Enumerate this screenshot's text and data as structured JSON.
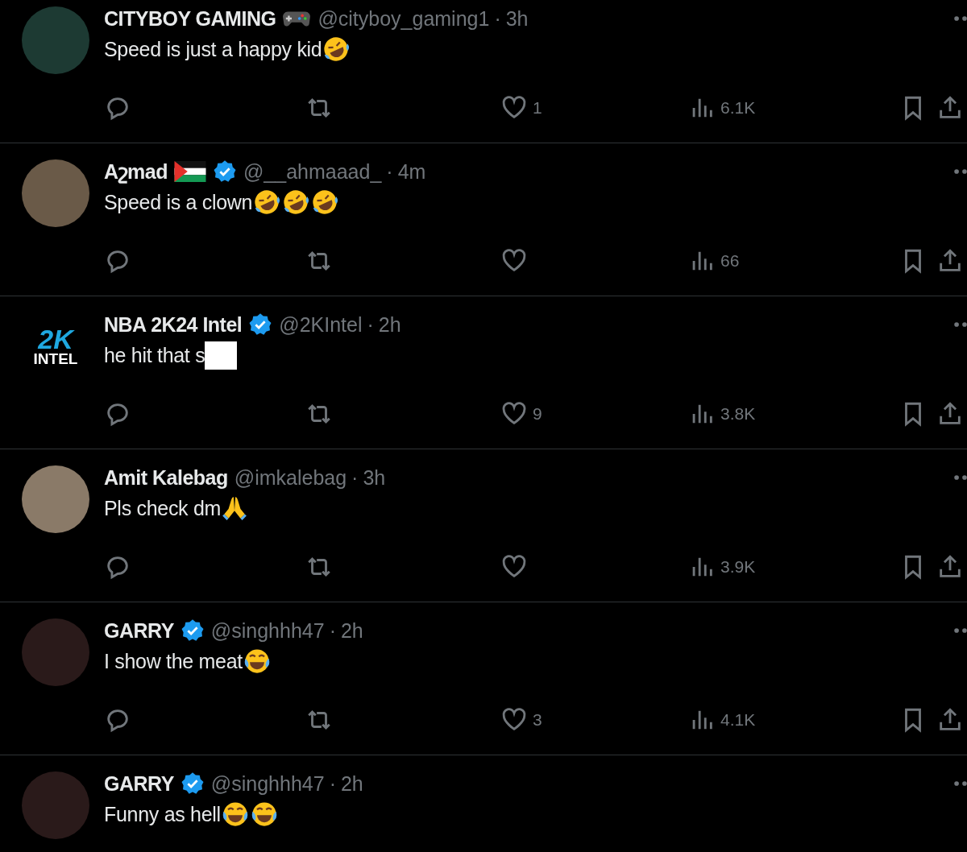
{
  "tweets": [
    {
      "avatar": {
        "kind": "photo"
      },
      "name": "CITYBOY GAMING",
      "name_badges": [
        {
          "kind": "gamepad"
        }
      ],
      "handle": "@cityboy_gaming1",
      "separator": "·",
      "time": "3h",
      "text": "Speed is just a happy kid",
      "emoji": [
        {
          "kind": "rofl"
        }
      ],
      "redacted": false,
      "actions": true,
      "likes": "1",
      "views": "6.1K"
    },
    {
      "avatar": {
        "kind": "photo"
      },
      "name": "Aշmad",
      "name_badges": [
        {
          "kind": "flag"
        },
        {
          "kind": "verified"
        }
      ],
      "handle": "@__ahmaaad_",
      "separator": "·",
      "time": "4m",
      "text": "Speed is a clown",
      "emoji": [
        {
          "kind": "rofl"
        },
        {
          "kind": "rofl"
        },
        {
          "kind": "rofl"
        }
      ],
      "redacted": false,
      "actions": true,
      "views": "66"
    },
    {
      "avatar": {
        "kind": "logo",
        "lines": [
          "2K",
          "INTEL"
        ]
      },
      "name": "NBA 2K24 Intel",
      "name_badges": [
        {
          "kind": "verified"
        }
      ],
      "handle": "@2KIntel",
      "separator": "·",
      "time": "2h",
      "text": "he hit that s",
      "redacted": true,
      "actions": true,
      "likes": "9",
      "views": "3.8K"
    },
    {
      "avatar": {
        "kind": "photo"
      },
      "name": "Amit Kalebag",
      "handle": "@imkalebag",
      "separator": "·",
      "time": "3h",
      "text": "Pls check dm",
      "emoji": [
        {
          "kind": "pray"
        }
      ],
      "redacted": false,
      "actions": true,
      "views": "3.9K"
    },
    {
      "avatar": {
        "kind": "photo"
      },
      "name": "GARRY",
      "name_badges": [
        {
          "kind": "verified"
        }
      ],
      "handle": "@singhhh47",
      "separator": "·",
      "time": "2h",
      "text": "I show the meat",
      "emoji": [
        {
          "kind": "joy"
        }
      ],
      "redacted": false,
      "actions": true,
      "likes": "3",
      "views": "4.1K"
    },
    {
      "avatar": {
        "kind": "photo"
      },
      "name": "GARRY",
      "name_badges": [
        {
          "kind": "verified"
        }
      ],
      "handle": "@singhhh47",
      "separator": "·",
      "time": "2h",
      "text": "Funny as hell",
      "emoji": [
        {
          "kind": "joy"
        },
        {
          "kind": "joy"
        }
      ],
      "redacted": false,
      "actions": false
    }
  ]
}
